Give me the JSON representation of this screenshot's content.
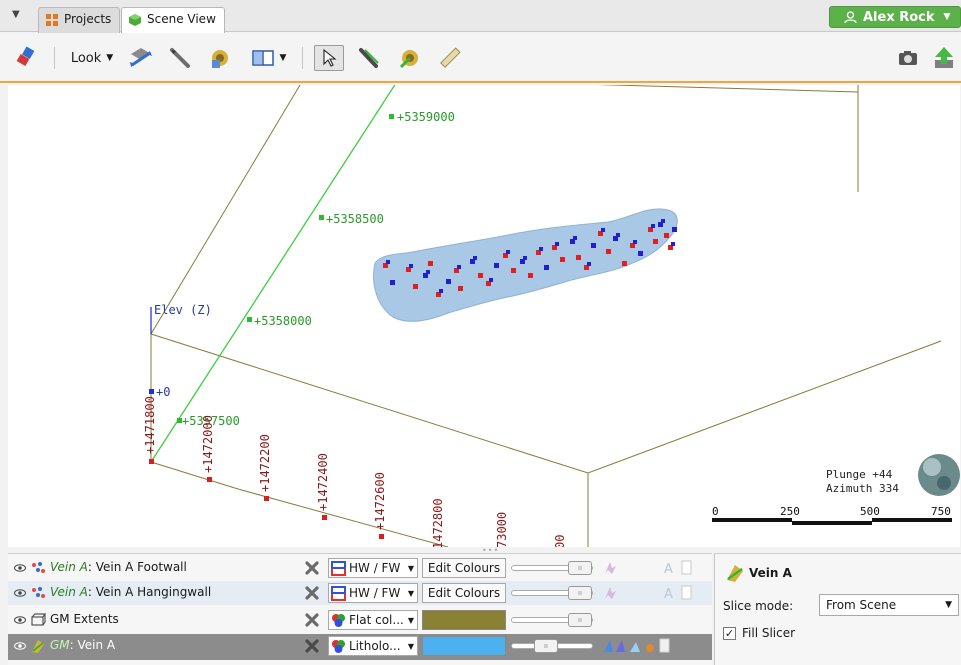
{
  "tabs": [
    {
      "label": "Projects",
      "icon": "projects-icon"
    },
    {
      "label": "Scene View",
      "icon": "scene-view-icon"
    }
  ],
  "user": {
    "name": "Alex Rock",
    "icon": "user-icon"
  },
  "toolbar": {
    "look_label": "Look",
    "tools": [
      "eraser-icon",
      "look-dropdown",
      "view-direction-icon",
      "pencil-icon",
      "gear-cube-icon",
      "layout-icon",
      "select-pointer-icon",
      "draw-line-icon",
      "gear-green-icon",
      "ruler-icon",
      "camera-icon",
      "export-icon"
    ]
  },
  "scene": {
    "elev_label": "Elev (Z)",
    "elev_zero": "+0",
    "north_labels": [
      "+5359000",
      "+5358500",
      "+5358000",
      "+5357500"
    ],
    "east_labels": [
      "+1471800",
      "+1472000",
      "+1472200",
      "+1472400",
      "+1472600",
      "1472800",
      "73000",
      "00"
    ],
    "orientation": {
      "plunge": "Plunge +44",
      "azimuth": "Azimuth 334"
    },
    "scale_ticks": [
      "0",
      "250",
      "500",
      "750"
    ],
    "colors": {
      "box": "#8a7a3a",
      "north_axis": "#3ccf3c",
      "surface": "#a8c8e6",
      "marker_red": "#e02020",
      "marker_blue": "#2020d0"
    }
  },
  "layers": [
    {
      "object": "Vein A",
      "name": ": Vein A Footwall",
      "italic": true,
      "colour_mode": "HW / FW",
      "action": "Edit Colours",
      "icon": "footwall-points-icon"
    },
    {
      "object": "Vein A",
      "name": ": Vein A Hangingwall",
      "italic": true,
      "colour_mode": "HW / FW",
      "action": "Edit Colours",
      "icon": "hangingwall-points-icon"
    },
    {
      "object": "",
      "name": "GM Extents",
      "italic": false,
      "colour_mode": "Flat col...",
      "swatch": "#8b8135",
      "icon": "extents-box-icon"
    },
    {
      "object": "GM",
      "name": ": Vein A",
      "italic": true,
      "colour_mode": "Litholo...",
      "swatch": "#4db1f0",
      "icon": "vein-icon"
    }
  ],
  "properties": {
    "title": "Vein A",
    "slice_mode_label": "Slice mode:",
    "slice_mode_value": "From Scene",
    "fill_slicer_label": "Fill Slicer",
    "fill_slicer_checked": true
  }
}
